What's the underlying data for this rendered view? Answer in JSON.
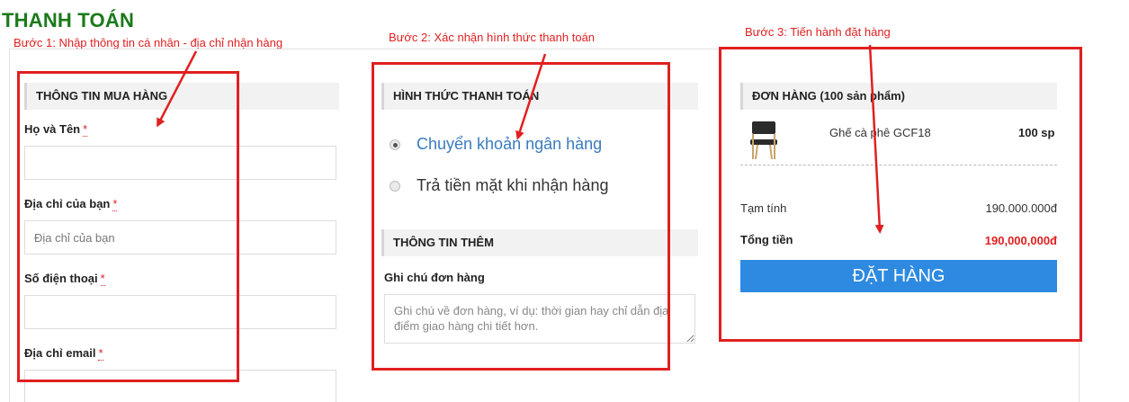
{
  "page": {
    "title": "THANH TOÁN"
  },
  "steps": {
    "step1": "Bước 1: Nhập thông tin cá nhân - địa chỉ nhận hàng",
    "step2": "Bước 2: Xác nhận hình thức thanh toán",
    "step3": "Bước 3: Tiến hành đặt hàng"
  },
  "buyer": {
    "header": "THÔNG TIN MUA HÀNG",
    "required_mark": "*",
    "fields": [
      {
        "label": "Họ và Tên",
        "value": "",
        "placeholder": ""
      },
      {
        "label": "Địa chỉ của bạn",
        "value": "",
        "placeholder": "Địa chỉ của bạn"
      },
      {
        "label": "Số điện thoại",
        "value": "",
        "placeholder": ""
      },
      {
        "label": "Địa chỉ email",
        "value": "",
        "placeholder": ""
      }
    ]
  },
  "payment": {
    "header": "HÌNH THỨC THANH TOÁN",
    "options": [
      {
        "label": "Chuyển khoản ngân hàng",
        "selected": true
      },
      {
        "label": "Trả tiền mặt khi nhận hàng",
        "selected": false
      }
    ]
  },
  "extra": {
    "header": "THÔNG TIN THÊM",
    "note_label": "Ghi chú đơn hàng",
    "note_placeholder": "Ghi chú về đơn hàng, ví dụ: thời gian hay chỉ dẫn địa điểm giao hàng chi tiết hơn.",
    "note_value": ""
  },
  "order": {
    "header": "ĐƠN HÀNG (100 sản phẩm)",
    "item": {
      "name": "Ghế cà phê GCF18",
      "qty": "100 sp",
      "thumbnail_icon": "chair-icon"
    },
    "subtotal_label": "Tạm tính",
    "subtotal_value": "190.000.000đ",
    "total_label": "Tổng tiền",
    "total_value": "190,000,000đ",
    "button_label": "ĐẶT HÀNG"
  },
  "colors": {
    "title_green": "#1a7a1a",
    "annotation_red": "#e02020",
    "link_blue": "#3a7bbf",
    "button_blue": "#2d8ae0"
  }
}
